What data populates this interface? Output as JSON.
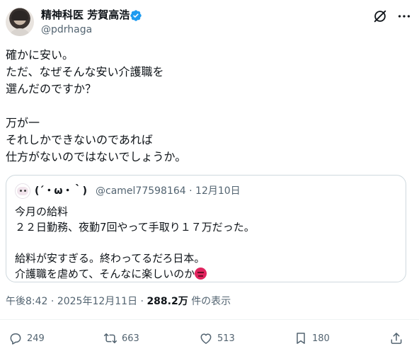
{
  "author": {
    "display_name": "精神科医 芳賀高浩",
    "handle": "@pdrhaga",
    "verified": true
  },
  "tweet": {
    "lines": [
      "確かに安い。",
      "ただ、なぜそんな安い介護職を",
      "選んだのですか？",
      "",
      "万が一",
      "それしかできないのであれば",
      "仕方がないのではないでしょうか。"
    ]
  },
  "quote": {
    "display_name": "(´・ω・｀)",
    "handle": "@camel77598164",
    "separator": "·",
    "date": "12月10日",
    "lines": [
      "今月の給料",
      "２２日勤務、夜勤7回やって手取り１７万だった。",
      "",
      "給料が安すぎる。終わってるだろ日本。",
      "介護職を虐めて、そんなに楽しいのか"
    ],
    "trailing_emoji": "angry-face-icon"
  },
  "meta": {
    "time": "午後8:42",
    "separator": "·",
    "date": "2025年12月11日",
    "views_count": "288.2万",
    "views_label": "件の表示"
  },
  "actions": {
    "replies": "249",
    "reposts": "663",
    "likes": "513",
    "bookmarks": "180"
  },
  "colors": {
    "text": "#0f1419",
    "secondary": "#536471",
    "verified": "#1d9bf0",
    "border": "#cfd9de"
  }
}
